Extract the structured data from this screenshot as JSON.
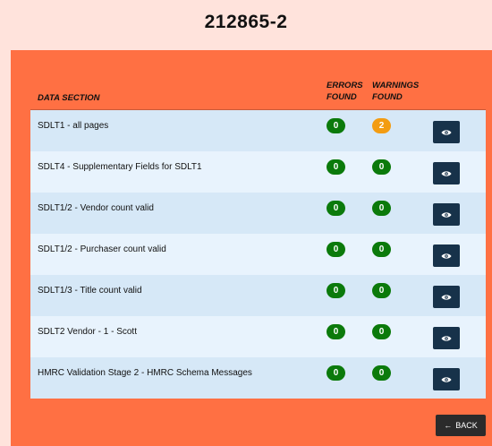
{
  "page": {
    "title": "212865-2"
  },
  "table": {
    "headers": {
      "section": "DATA SECTION",
      "errors": "ERRORS FOUND",
      "warnings": "WARNINGS FOUND"
    },
    "rows": [
      {
        "label": "SDLT1 - all pages",
        "errors": "0",
        "warnings": "2"
      },
      {
        "label": "SDLT4 - Supplementary Fields for SDLT1",
        "errors": "0",
        "warnings": "0"
      },
      {
        "label": "SDLT1/2 - Vendor count valid",
        "errors": "0",
        "warnings": "0"
      },
      {
        "label": "SDLT1/2 - Purchaser count valid",
        "errors": "0",
        "warnings": "0"
      },
      {
        "label": "SDLT1/3 - Title count valid",
        "errors": "0",
        "warnings": "0"
      },
      {
        "label": "SDLT2 Vendor - 1 - Scott",
        "errors": "0",
        "warnings": "0"
      },
      {
        "label": "HMRC Validation Stage 2 - HMRC Schema Messages",
        "errors": "0",
        "warnings": "0"
      }
    ]
  },
  "footer": {
    "back_label": "BACK"
  },
  "colors": {
    "page_bg": "#ffe3dc",
    "panel": "#ff7043",
    "badge_ok": "#0b7a0b",
    "badge_warning": "#f39c12",
    "view_button": "#17324a"
  },
  "icons": {
    "view": "eye-icon",
    "back": "arrow-left-icon"
  }
}
